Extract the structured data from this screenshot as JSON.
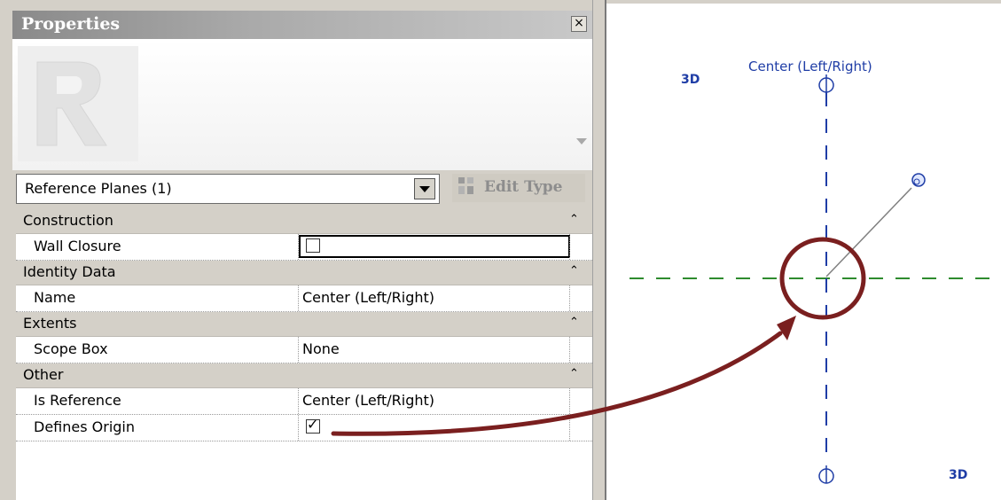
{
  "palette": {
    "title": "Properties",
    "close_glyph": "×",
    "type_selector_value": "Reference Planes (1)",
    "edit_type_label": "Edit Type",
    "groups": [
      {
        "label": "Construction",
        "rows": [
          {
            "name": "Wall Closure",
            "kind": "checkbox",
            "checked": false
          }
        ]
      },
      {
        "label": "Identity Data",
        "rows": [
          {
            "name": "Name",
            "value": "Center (Left/Right)"
          }
        ]
      },
      {
        "label": "Extents",
        "rows": [
          {
            "name": "Scope Box",
            "value": "None"
          }
        ]
      },
      {
        "label": "Other",
        "rows": [
          {
            "name": "Is Reference",
            "value": "Center (Left/Right)"
          },
          {
            "name": "Defines Origin",
            "kind": "checkbox",
            "checked": true
          }
        ]
      }
    ],
    "collapse_glyph": "⌃"
  },
  "view": {
    "label_3d": "3D",
    "plane_name": "Center (Left/Right)",
    "colors": {
      "reference_plane": "#1f3da6",
      "level_line": "#2e8b2e",
      "callout": "#7a1f1f"
    }
  }
}
